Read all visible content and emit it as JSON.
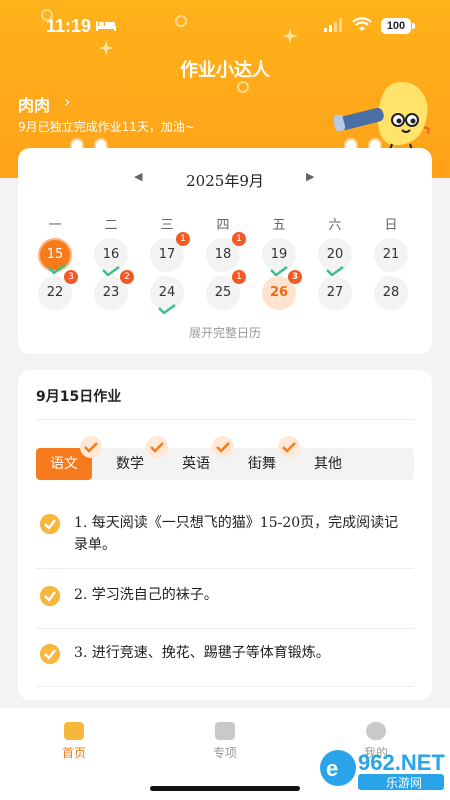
{
  "status_bar": {
    "time": "11:19",
    "battery": "100"
  },
  "app": {
    "title": "作业小达人"
  },
  "user": {
    "name": "肉肉",
    "message": "9月已独立完成作业11天，加油~"
  },
  "calendar": {
    "month_label": "2025年9月",
    "weekdays": [
      "一",
      "二",
      "三",
      "四",
      "五",
      "六",
      "日"
    ],
    "week1": [
      {
        "day": "15",
        "badge": "",
        "done": true,
        "state": "today"
      },
      {
        "day": "16",
        "badge": "",
        "done": true,
        "state": ""
      },
      {
        "day": "17",
        "badge": "1",
        "done": false,
        "state": ""
      },
      {
        "day": "18",
        "badge": "1",
        "done": false,
        "state": ""
      },
      {
        "day": "19",
        "badge": "",
        "done": true,
        "state": ""
      },
      {
        "day": "20",
        "badge": "",
        "done": true,
        "state": ""
      },
      {
        "day": "21",
        "badge": "",
        "done": false,
        "state": ""
      }
    ],
    "week2": [
      {
        "day": "22",
        "badge": "3",
        "done": false,
        "state": ""
      },
      {
        "day": "23",
        "badge": "2",
        "done": false,
        "state": ""
      },
      {
        "day": "24",
        "badge": "",
        "done": true,
        "state": ""
      },
      {
        "day": "25",
        "badge": "1",
        "done": false,
        "state": ""
      },
      {
        "day": "26",
        "badge": "3",
        "done": false,
        "state": "selected"
      },
      {
        "day": "27",
        "badge": "",
        "done": false,
        "state": ""
      },
      {
        "day": "28",
        "badge": "",
        "done": false,
        "state": ""
      }
    ],
    "expand_label": "展开完整日历"
  },
  "homework": {
    "title": "9月15日作业",
    "subjects": [
      {
        "label": "语文",
        "active": true,
        "checked": true
      },
      {
        "label": "数学",
        "active": false,
        "checked": true
      },
      {
        "label": "英语",
        "active": false,
        "checked": true
      },
      {
        "label": "街舞",
        "active": false,
        "checked": true
      },
      {
        "label": "其他",
        "active": false,
        "checked": false
      }
    ],
    "tasks": [
      "1. 每天阅读《一只想飞的猫》15-20页，完成阅读记录单。",
      "2. 学习洗自己的袜子。",
      "3. 进行竞速、挽花、踢毽子等体育锻炼。"
    ]
  },
  "tabbar": {
    "items": [
      {
        "label": "首页",
        "active": true
      },
      {
        "label": "专项",
        "active": false
      },
      {
        "label": "我的",
        "active": false
      }
    ]
  },
  "watermark": {
    "top": "962.NET",
    "bottom": "乐游网"
  },
  "colors": {
    "brand": "#ffa21a",
    "accent": "#f77a1c",
    "badge": "#f15a24",
    "check": "#3cc08d"
  }
}
